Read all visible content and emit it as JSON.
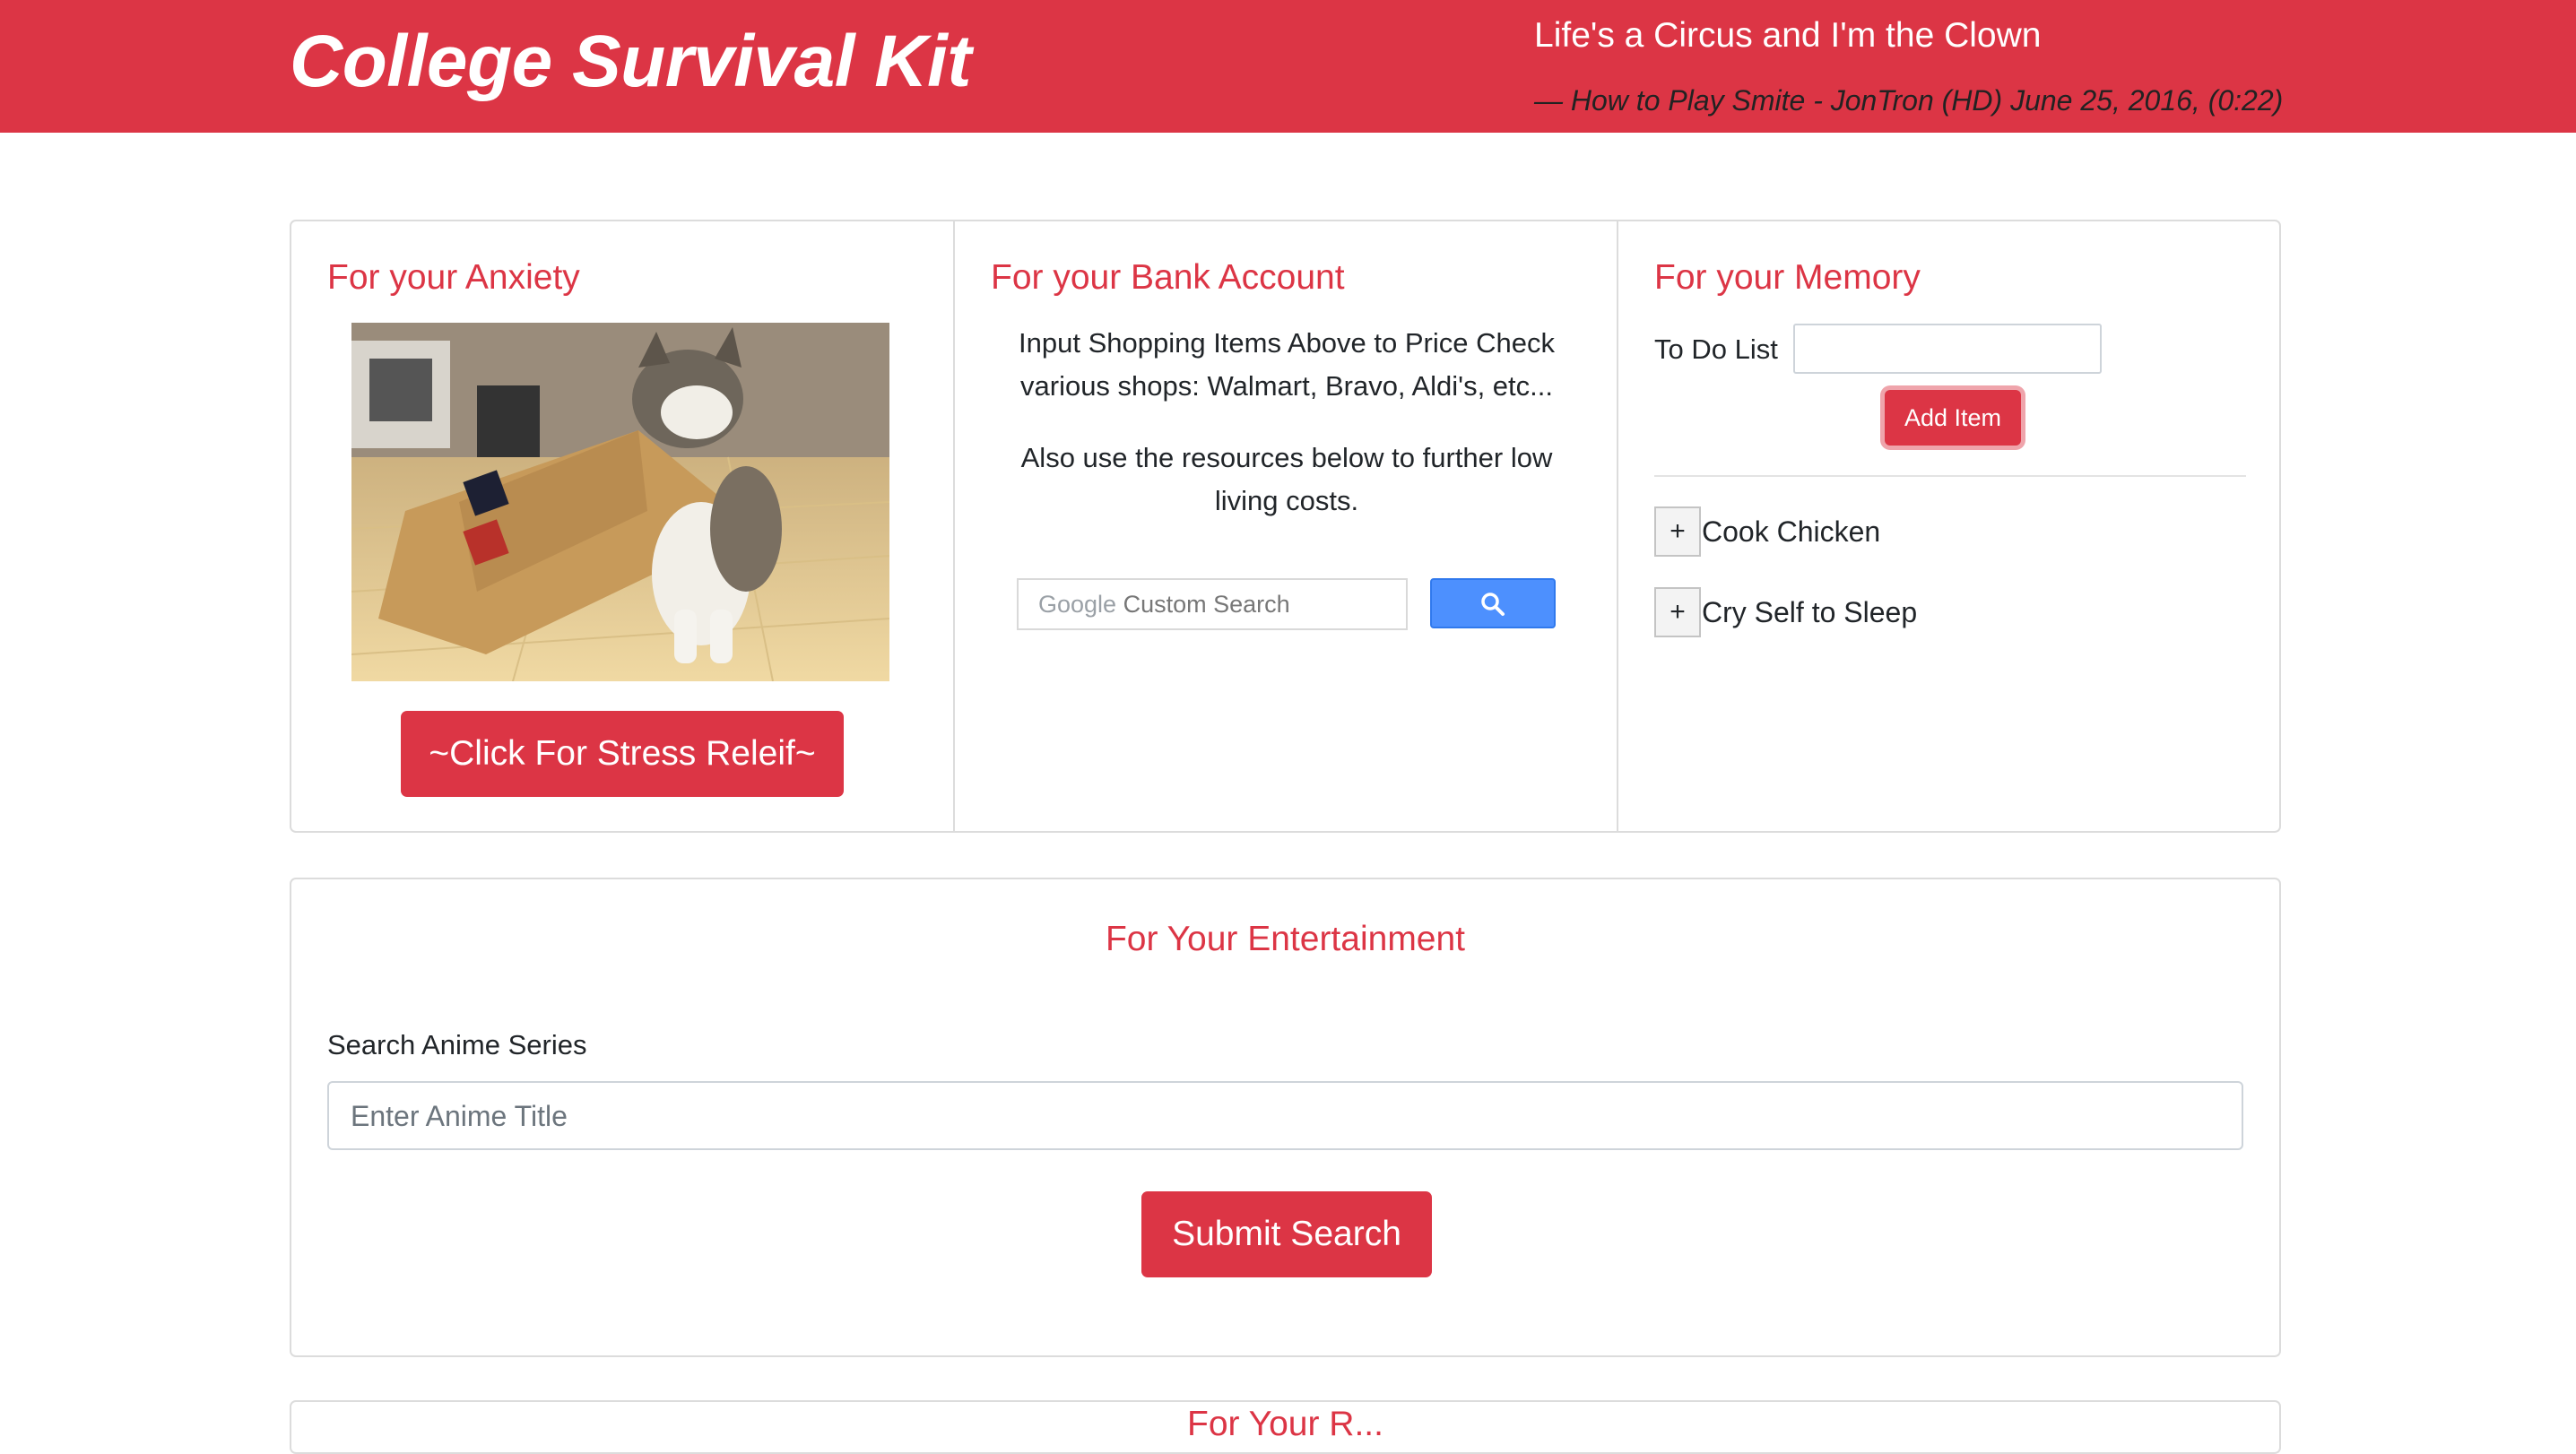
{
  "header": {
    "title": "College Survival Kit",
    "quote": "Life's a Circus and I'm the Clown",
    "citation": "— How to Play Smite - JonTron (HD) June 25, 2016, (0:22)"
  },
  "anxiety": {
    "title": "For your Anxiety",
    "button": "~Click For Stress Releif~"
  },
  "bank": {
    "title": "For your Bank Account",
    "text1": "Input Shopping Items Above to Price Check various shops: Walmart, Bravo, Aldi's, etc...",
    "text2": "Also use the resources below to further low living costs.",
    "search_brand": "Google",
    "search_placeholder": "Custom Search"
  },
  "memory": {
    "title": "For your Memory",
    "todo_label": "To Do List",
    "add_button": "Add Item",
    "items": [
      {
        "text": "Cook Chicken",
        "icon": "+"
      },
      {
        "text": "Cry Self to Sleep",
        "icon": "+"
      }
    ]
  },
  "entertainment": {
    "title": "For Your Entertainment",
    "search_label": "Search Anime Series",
    "search_placeholder": "Enter Anime Title",
    "submit_button": "Submit Search"
  },
  "next_section": {
    "title": "For Your R..."
  },
  "colors": {
    "accent": "#dc3545",
    "google_button": "#4d90fe"
  }
}
